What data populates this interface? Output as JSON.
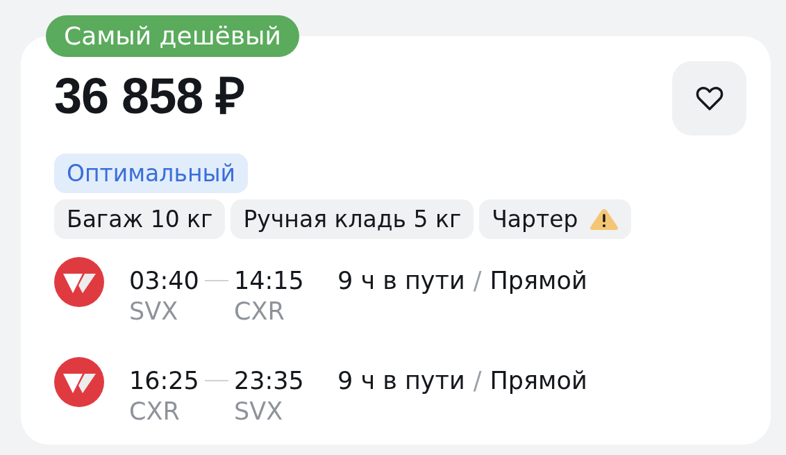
{
  "badge": "Самый дешёвый",
  "price": "36 858 ₽",
  "fare": "Оптимальный",
  "features": [
    {
      "label": "Багаж 10 кг",
      "kind": "plain"
    },
    {
      "label": "Ручная кладь 5 кг",
      "kind": "plain"
    },
    {
      "label": "Чартер",
      "kind": "warning"
    }
  ],
  "flights": [
    {
      "departure_time": "03:40",
      "arrival_time": "14:15",
      "departure_airport": "SVX",
      "arrival_airport": "CXR",
      "duration": "9 ч в пути",
      "separator": "/",
      "stops": "Прямой"
    },
    {
      "departure_time": "16:25",
      "arrival_time": "23:35",
      "departure_airport": "CXR",
      "arrival_airport": "SVX",
      "duration": "9 ч в пути",
      "separator": "/",
      "stops": "Прямой"
    }
  ]
}
